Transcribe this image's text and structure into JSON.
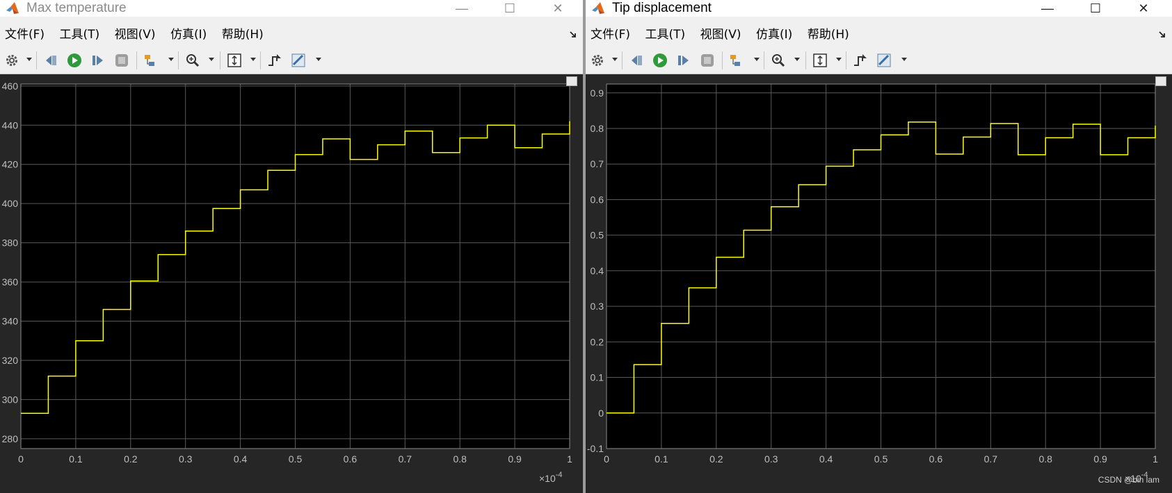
{
  "menu": [
    "文件(F)",
    "工具(T)",
    "视图(V)",
    "仿真(I)",
    "帮助(H)"
  ],
  "window_controls": {
    "minimize": "—",
    "maximize": "☐",
    "close": "✕"
  },
  "watermark": "CSDN @bin lam",
  "colors": {
    "plot_bg": "#000000",
    "frame_bg": "#262626",
    "grid": "#5a5a5a",
    "signal": "#ffff00",
    "axis_text": "#bfbfbf"
  },
  "windows": [
    {
      "title": "Max temperature",
      "chart_data": {
        "type": "line",
        "step": true,
        "x": [
          0,
          0.05,
          0.1,
          0.15,
          0.2,
          0.25,
          0.3,
          0.35,
          0.4,
          0.45,
          0.5,
          0.55,
          0.6,
          0.65,
          0.7,
          0.75,
          0.8,
          0.85,
          0.9,
          0.95,
          1.0
        ],
        "y": [
          293,
          312,
          330,
          346,
          360.5,
          374,
          386,
          397.5,
          407,
          417,
          425,
          433,
          422.5,
          430,
          437,
          426,
          433.5,
          440,
          428.5,
          435.5,
          442
        ],
        "xlim": [
          0,
          1
        ],
        "ylim": [
          275,
          461
        ],
        "xticks": [
          "0",
          "0.1",
          "0.2",
          "0.3",
          "0.4",
          "0.5",
          "0.6",
          "0.7",
          "0.8",
          "0.9",
          "1"
        ],
        "xtick_values": [
          0,
          0.1,
          0.2,
          0.3,
          0.4,
          0.5,
          0.6,
          0.7,
          0.8,
          0.9,
          1.0
        ],
        "yticks": [
          "280",
          "300",
          "320",
          "340",
          "360",
          "380",
          "400",
          "420",
          "440",
          "460"
        ],
        "ytick_values": [
          280,
          300,
          320,
          340,
          360,
          380,
          400,
          420,
          440,
          460
        ],
        "x_exponent": "×10",
        "x_exponent_power": "-4",
        "grid": true
      }
    },
    {
      "title": "Tip displacement",
      "chart_data": {
        "type": "line",
        "step": true,
        "x": [
          0,
          0.05,
          0.1,
          0.15,
          0.2,
          0.25,
          0.3,
          0.35,
          0.4,
          0.45,
          0.5,
          0.55,
          0.6,
          0.65,
          0.7,
          0.75,
          0.8,
          0.85,
          0.9,
          0.95,
          1.0
        ],
        "y": [
          0,
          0.136,
          0.252,
          0.352,
          0.438,
          0.514,
          0.58,
          0.642,
          0.694,
          0.74,
          0.782,
          0.818,
          0.728,
          0.776,
          0.814,
          0.726,
          0.774,
          0.812,
          0.726,
          0.774,
          0.808
        ],
        "xlim": [
          0,
          1
        ],
        "ylim": [
          -0.1,
          0.925
        ],
        "xticks": [
          "0",
          "0.1",
          "0.2",
          "0.3",
          "0.4",
          "0.5",
          "0.6",
          "0.7",
          "0.8",
          "0.9",
          "1"
        ],
        "xtick_values": [
          0,
          0.1,
          0.2,
          0.3,
          0.4,
          0.5,
          0.6,
          0.7,
          0.8,
          0.9,
          1.0
        ],
        "yticks": [
          "-0.1",
          "0",
          "0.1",
          "0.2",
          "0.3",
          "0.4",
          "0.5",
          "0.6",
          "0.7",
          "0.8",
          "0.9"
        ],
        "ytick_values": [
          -0.1,
          0,
          0.1,
          0.2,
          0.3,
          0.4,
          0.5,
          0.6,
          0.7,
          0.8,
          0.9
        ],
        "x_exponent": "×10",
        "x_exponent_power": "-4",
        "grid": true
      }
    }
  ]
}
